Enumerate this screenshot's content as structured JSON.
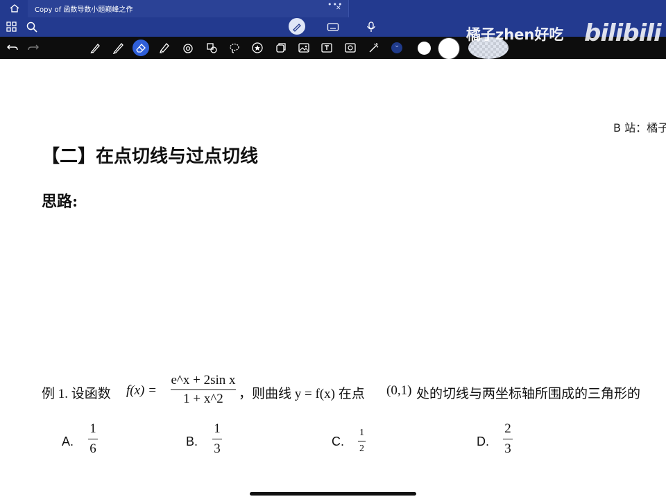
{
  "tab": {
    "title": "Copy of 函数导数小题巅峰之作"
  },
  "watermark": {
    "channel": "橘子zhen好吃",
    "logo": "bilibili"
  },
  "toolbar": {
    "tools": [
      "pen",
      "pencil",
      "eraser",
      "highlighter",
      "shape",
      "lasso-shape",
      "lasso",
      "star-sticker",
      "element",
      "image",
      "text",
      "screenshot",
      "laser-pointer"
    ],
    "selected_tool": "eraser",
    "colors": [
      "#ffffff",
      "#ffffff"
    ],
    "accent": "#2f5fd8"
  },
  "document": {
    "header_credit": "B 站：橘子",
    "section_title": "【二】在点切线与过点切线",
    "idea_label": "思路:",
    "example": {
      "prefix": "例 1. 设函数",
      "f_of_x": "f(x) =",
      "numerator": "e^x + 2sin x",
      "denominator": "1 + x^2",
      "middle": "，则曲线 y = f(x) 在点",
      "point": "(0,1)",
      "suffix": "处的切线与两坐标轴所围成的三角形的"
    },
    "options": [
      {
        "letter": "A.",
        "num": "1",
        "den": "6"
      },
      {
        "letter": "B.",
        "num": "1",
        "den": "3"
      },
      {
        "letter": "C.",
        "num": "1",
        "den": "2"
      },
      {
        "letter": "D.",
        "num": "2",
        "den": "3"
      }
    ]
  }
}
